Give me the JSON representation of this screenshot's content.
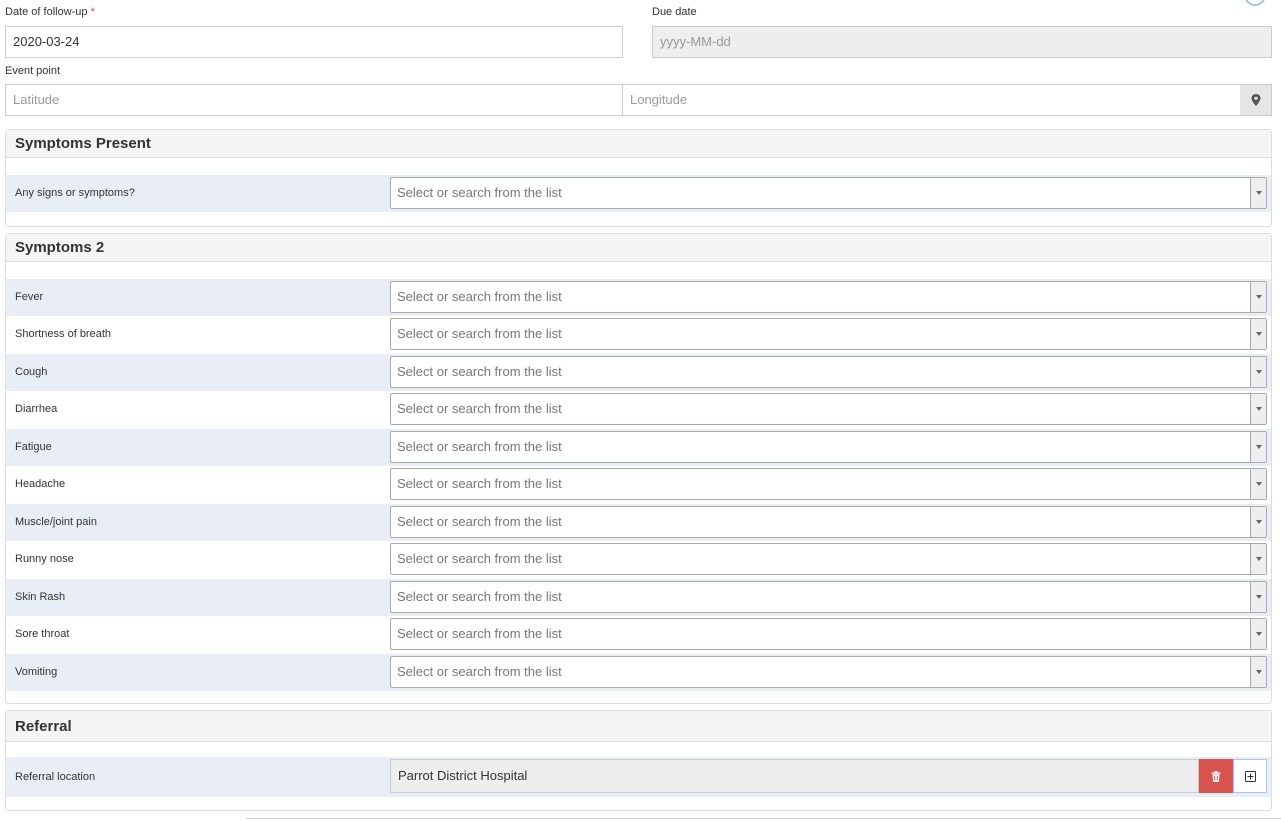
{
  "follow_up": {
    "date_label": "Date of follow-up",
    "required_mark": "*",
    "date_value": "2020-03-24",
    "due_date_label": "Due date",
    "due_date_placeholder": "yyyy-MM-dd"
  },
  "event_point": {
    "label": "Event point",
    "latitude_placeholder": "Latitude",
    "longitude_placeholder": "Longitude",
    "location_icon": "map-marker-icon"
  },
  "select_placeholder": "Select or search from the list",
  "sections": [
    {
      "title": "Symptoms Present",
      "fields": [
        {
          "label": "Any signs or symptoms?"
        }
      ]
    },
    {
      "title": "Symptoms 2",
      "fields": [
        {
          "label": "Fever"
        },
        {
          "label": "Shortness of breath"
        },
        {
          "label": "Cough"
        },
        {
          "label": "Diarrhea"
        },
        {
          "label": "Fatigue"
        },
        {
          "label": "Headache"
        },
        {
          "label": "Muscle/joint pain"
        },
        {
          "label": "Runny nose"
        },
        {
          "label": "Skin Rash"
        },
        {
          "label": "Sore throat"
        },
        {
          "label": "Vomiting"
        }
      ]
    }
  ],
  "referral": {
    "title": "Referral",
    "location_label": "Referral location",
    "location_value": "Parrot District Hospital",
    "delete_icon": "trash-icon",
    "add_icon": "plus-square-icon"
  },
  "colors": {
    "row_shade": "#e9eef6",
    "panel_header": "#f5f5f5",
    "danger": "#d9534f",
    "required": "#d9534f"
  }
}
